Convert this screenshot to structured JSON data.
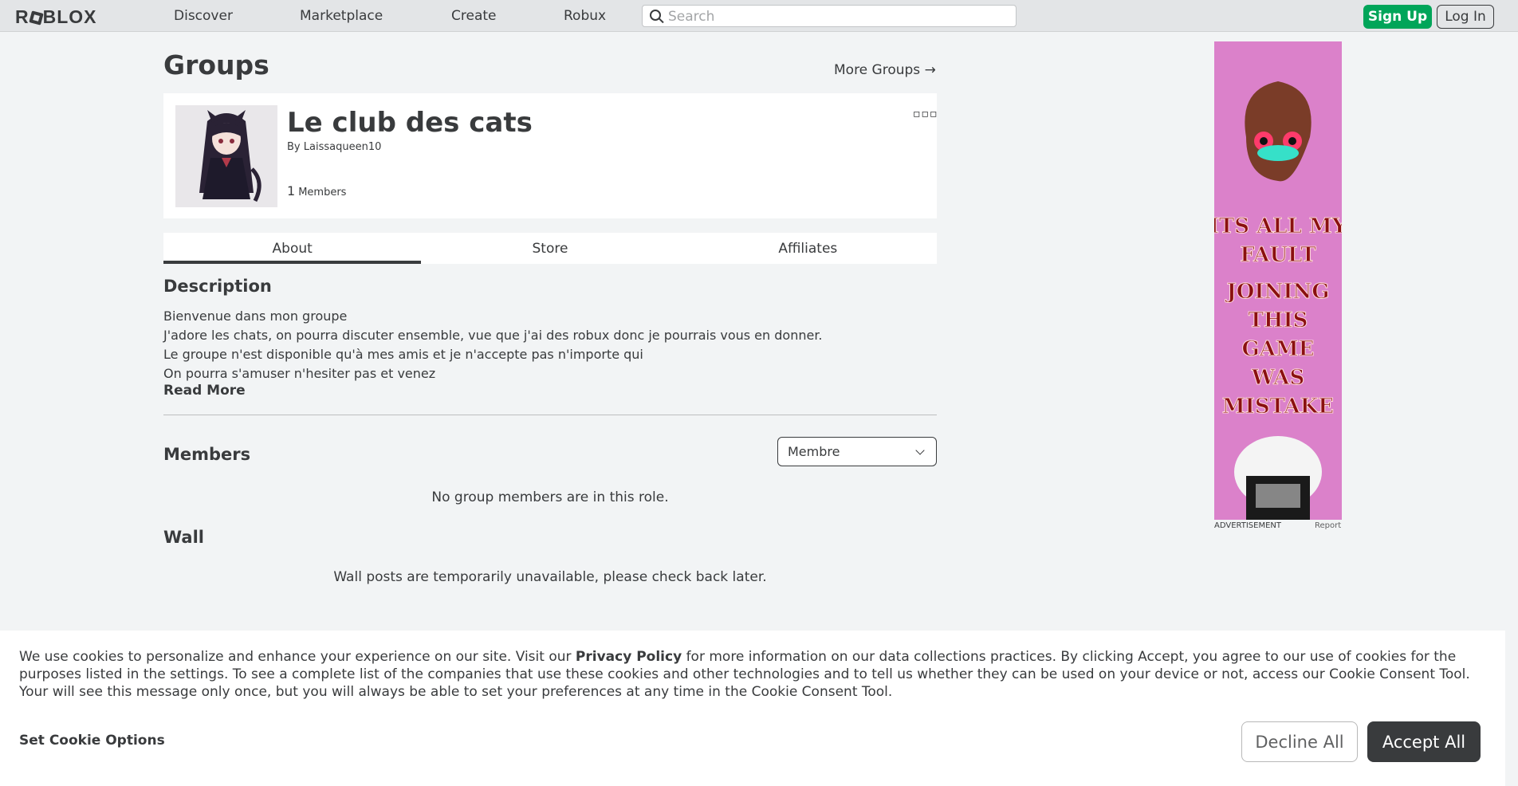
{
  "header": {
    "logo": "ROBLOX",
    "nav": [
      "Discover",
      "Marketplace",
      "Create",
      "Robux"
    ],
    "search_placeholder": "Search",
    "signup": "Sign Up",
    "login": "Log In"
  },
  "page": {
    "title": "Groups",
    "more_groups": "More Groups →"
  },
  "group": {
    "name": "Le club des cats",
    "by_prefix": "By",
    "owner": "Laissaqueen10",
    "member_count": "1",
    "members_label": "Members"
  },
  "tabs": [
    "About",
    "Store",
    "Affiliates"
  ],
  "description": {
    "title": "Description",
    "lines": [
      "Bienvenue dans mon groupe",
      "J'adore les chats, on pourra discuter ensemble, vue que j'ai des robux donc je pourrais vous en donner.",
      "Le groupe n'est disponible qu'à mes amis et je n'accepte pas n'importe qui",
      "On pourra s'amuser n'hesiter pas et venez"
    ],
    "read_more": "Read More"
  },
  "members": {
    "title": "Members",
    "role_selected": "Membre",
    "empty": "No group members are in this role."
  },
  "wall": {
    "title": "Wall",
    "unavailable": "Wall posts are temporarily unavailable, please check back later."
  },
  "ad": {
    "text_lines": [
      "ITS ALL MY",
      "FAULT",
      "JOINING",
      "THIS",
      "GAME",
      "WAS",
      "MISTAKE"
    ],
    "label": "ADVERTISEMENT",
    "report": "Report"
  },
  "cookie": {
    "text_before": "We use cookies to personalize and enhance your experience on our site. Visit our ",
    "privacy_link": "Privacy Policy",
    "text_after": " for more information on our data collections practices. By clicking Accept, you agree to our use of cookies for the purposes listed in the settings. To see a complete list of the companies that use these cookies and other technologies and to tell us whether they can be used on your device or not, access our Cookie Consent Tool. Your will see this message only once, but you will always be able to set your preferences at any time in the Cookie Consent Tool.",
    "set_options": "Set Cookie Options",
    "decline": "Decline All",
    "accept": "Accept All"
  },
  "colors": {
    "signup_green": "#00a559",
    "text_dark": "#393b3d",
    "page_bg": "#f2f4f5",
    "ad_pink": "#e58ad0"
  }
}
